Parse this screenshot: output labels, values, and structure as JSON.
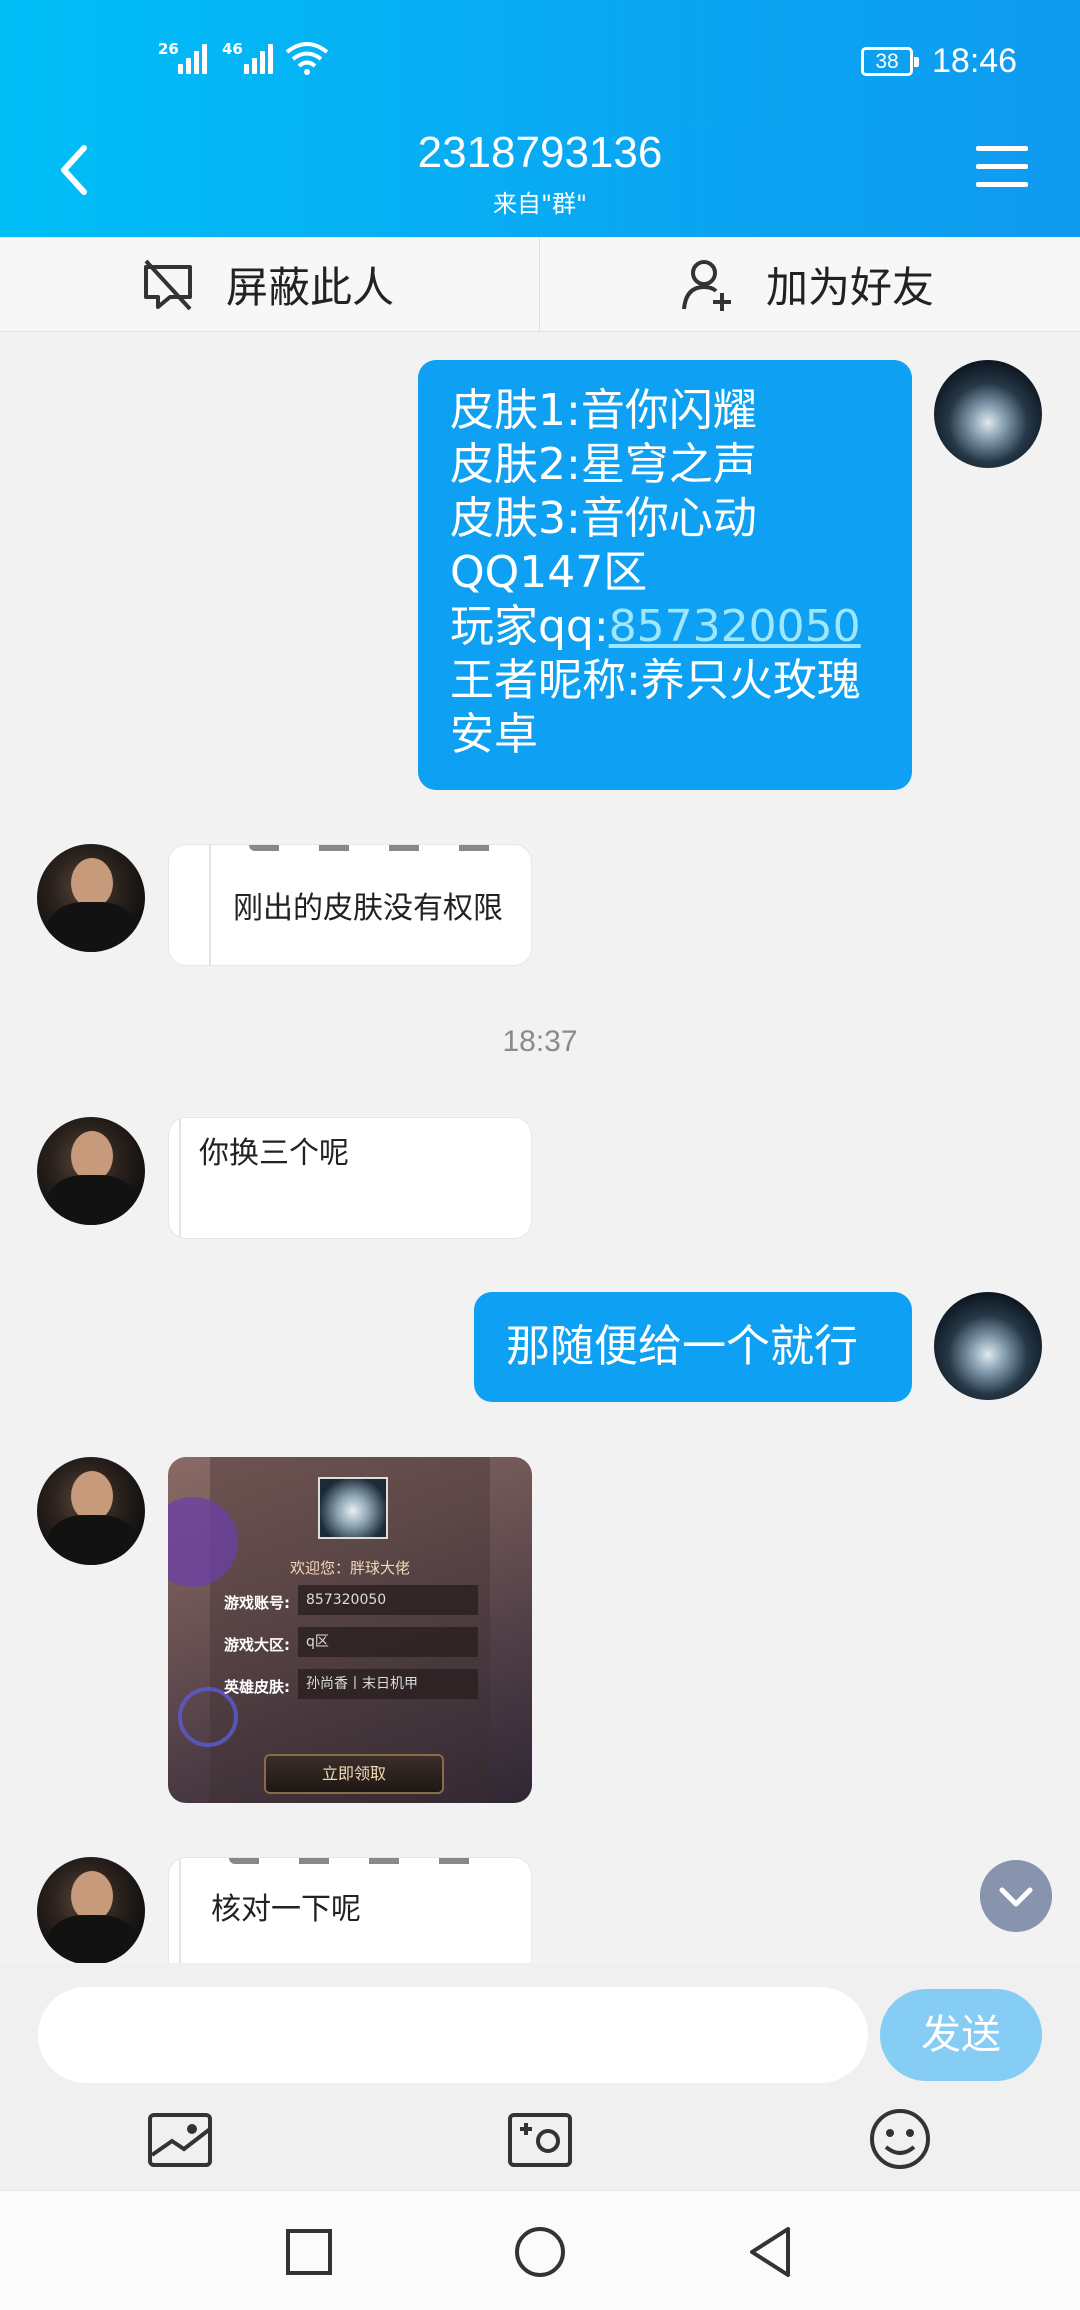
{
  "status_bar": {
    "signal1": "26",
    "signal2": "46",
    "battery": "38",
    "time": "18:46"
  },
  "header": {
    "title": "2318793136",
    "subtitle": "来自\"群\""
  },
  "actions": {
    "block": "屏蔽此人",
    "add_friend": "加为好友"
  },
  "messages": {
    "m1_lines": [
      "皮肤1:音你闪耀",
      "皮肤2:星穹之声",
      "皮肤3:音你心动",
      "QQ147区"
    ],
    "m1_qq_prefix": "玩家qq:",
    "m1_qq_link": "857320050",
    "m1_tail": [
      "王者昵称:养只火玫瑰",
      "安卓"
    ],
    "m2_text": "刚出的皮肤没有权限",
    "timestamp": "18:37",
    "m3_text": "你换三个呢",
    "m4_text": "那随便给一个就行",
    "m6_text": "核对一下呢"
  },
  "card": {
    "welcome": "欢迎您：胖球大佬",
    "account_label": "游戏账号:",
    "account_value": "857320050",
    "region_label": "游戏大区:",
    "region_value": "q区",
    "skin_label": "英雄皮肤:",
    "skin_value": "孙尚香丨末日机甲",
    "claim_button": "立即领取"
  },
  "composer": {
    "placeholder": "",
    "send_label": "发送"
  },
  "colors": {
    "header": "#0aa6f2",
    "bubble_me": "#0ea0f2",
    "send": "#86cdf6"
  }
}
